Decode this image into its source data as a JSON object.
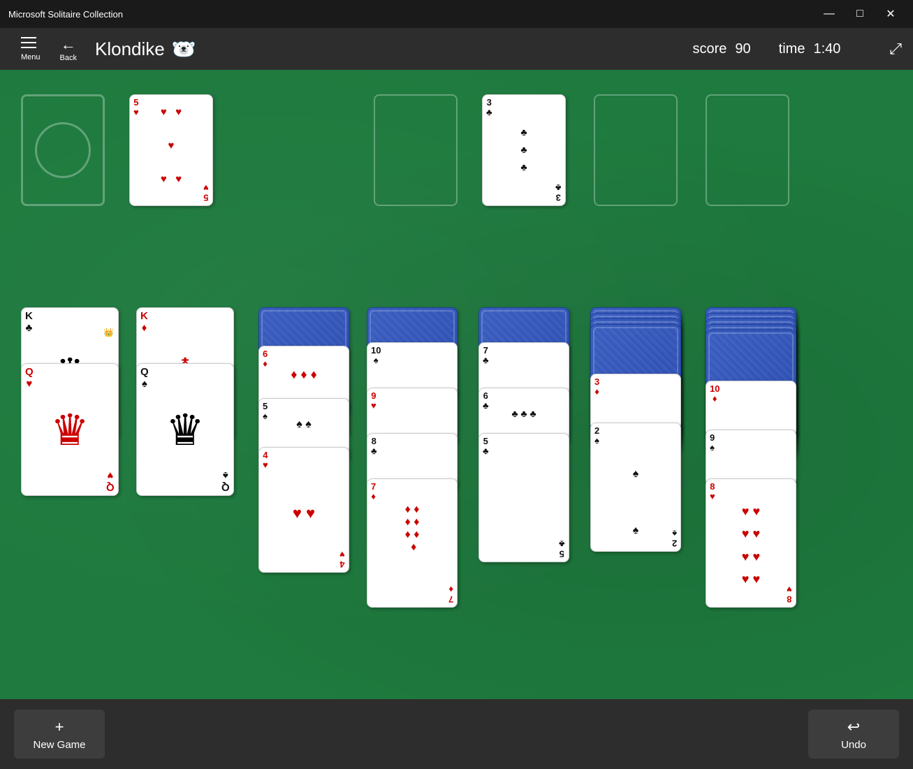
{
  "titleBar": {
    "title": "Microsoft Solitaire Collection",
    "minimize": "—",
    "maximize": "□",
    "close": "✕"
  },
  "header": {
    "menuLabel": "Menu",
    "backLabel": "Back",
    "gameTitle": "Klondike",
    "scoreLabel": "score",
    "scoreValue": "90",
    "timeLabel": "time",
    "timeValue": "1:40"
  },
  "bottomBar": {
    "newGameLabel": "New Game",
    "newGameIcon": "+",
    "undoLabel": "Undo",
    "undoIcon": "↩"
  },
  "tableau": {
    "col1": {
      "topCard": {
        "rank": "K",
        "suit": "♣",
        "color": "black"
      },
      "bottomCard": {
        "rank": "Q",
        "suit": "♥",
        "color": "red"
      }
    },
    "col2": {
      "topCard": {
        "rank": "K",
        "suit": "♦",
        "color": "red"
      },
      "bottomCard": {
        "rank": "Q",
        "suit": "♠",
        "color": "black"
      }
    }
  }
}
